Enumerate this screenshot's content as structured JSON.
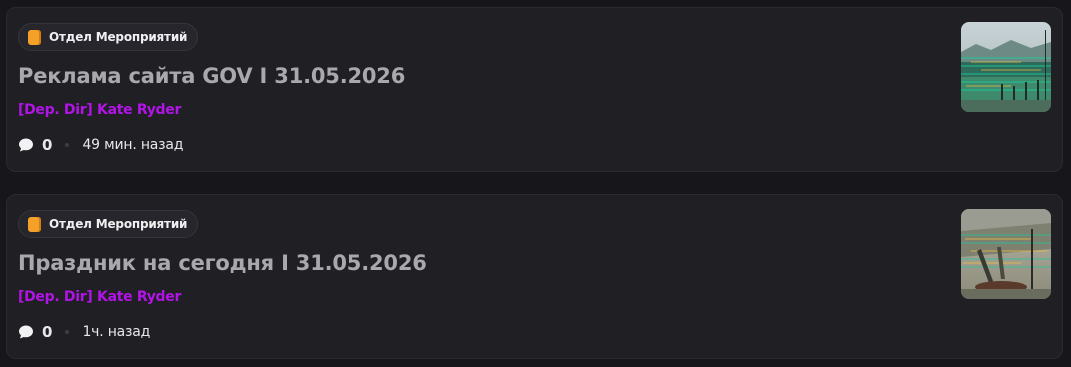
{
  "posts": [
    {
      "category": {
        "label": "Отдел Мероприятий",
        "icon": "orange-book-icon"
      },
      "title": "Реклама сайта GOV I 31.05.2026",
      "author": "[Dep. Dir] Kate Ryder",
      "comments": "0",
      "time": "49 мин. назад",
      "thumbnail": "outdoor-scene-thumbnail"
    },
    {
      "category": {
        "label": "Отдел Мероприятий",
        "icon": "orange-book-icon"
      },
      "title": "Праздник на сегодня I 31.05.2026",
      "author": "[Dep. Dir] Kate Ryder",
      "comments": "0",
      "time": "1ч. назад",
      "thumbnail": "outdoor-scene-thumbnail"
    }
  ],
  "colors": {
    "background": "#17171b",
    "card": "#1f1f24",
    "category_icon": "#f4a12a",
    "title": "#a8a8ad",
    "author": "#b214e8"
  }
}
